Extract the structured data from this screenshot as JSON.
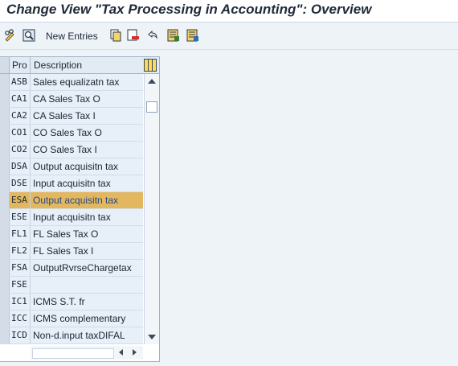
{
  "window": {
    "title": "Change View \"Tax Processing in Accounting\": Overview"
  },
  "toolbar": {
    "new_entries_label": "New Entries",
    "icons": [
      "pencil-glasses-icon",
      "magnifier-icon",
      "copy-icon",
      "delete-icon",
      "undo-icon",
      "select-all-icon",
      "deselect-all-icon"
    ]
  },
  "table": {
    "columns": [
      "Pro",
      "Description"
    ],
    "rows": [
      {
        "code": "ASB",
        "description": "Sales equalizatn tax"
      },
      {
        "code": "CA1",
        "description": "CA Sales Tax O"
      },
      {
        "code": "CA2",
        "description": "CA Sales Tax I"
      },
      {
        "code": "CO1",
        "description": "CO Sales Tax O"
      },
      {
        "code": "CO2",
        "description": "CO Sales Tax I"
      },
      {
        "code": "DSA",
        "description": "Output acquisitn tax"
      },
      {
        "code": "DSE",
        "description": "Input acquisitn tax"
      },
      {
        "code": "ESA",
        "description": "Output acquisitn tax"
      },
      {
        "code": "ESE",
        "description": "Input acquisitn tax"
      },
      {
        "code": "FL1",
        "description": "FL Sales Tax O"
      },
      {
        "code": "FL2",
        "description": "FL Sales Tax I"
      },
      {
        "code": "FSA",
        "description": "OutputRvrseChargetax"
      },
      {
        "code": "FSE",
        "description": ""
      },
      {
        "code": "IC1",
        "description": "ICMS S.T. fr"
      },
      {
        "code": "ICC",
        "description": "ICMS complementary"
      },
      {
        "code": "ICD",
        "description": "Non-d.input taxDIFAL"
      }
    ],
    "selected_code": "ESA"
  },
  "colors": {
    "selected_row": "#e3b760",
    "row_bg": "#e7eff8",
    "header_bg": "#e2ebf4"
  }
}
